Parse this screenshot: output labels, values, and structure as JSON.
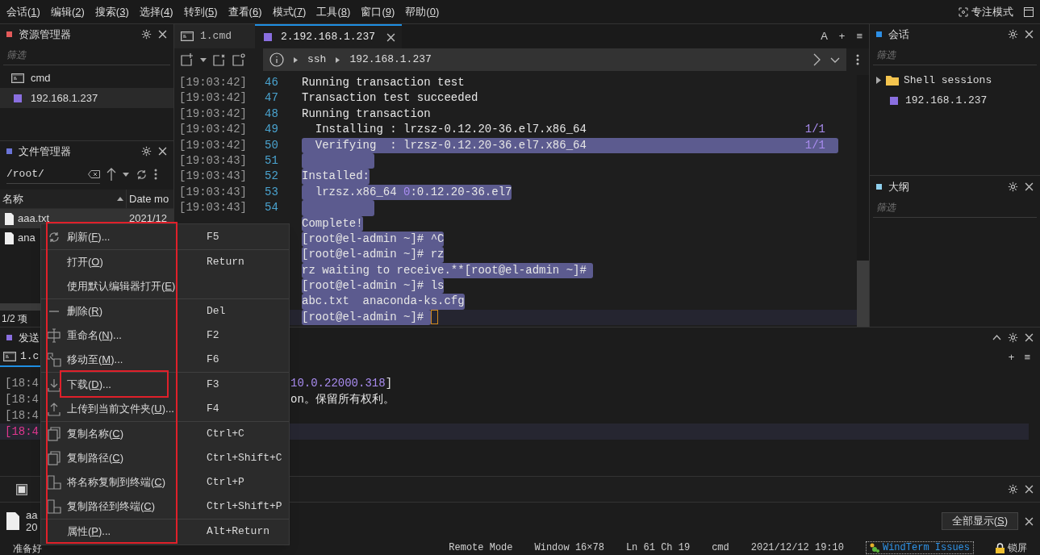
{
  "menubar": {
    "items": [
      {
        "pre": "会话(",
        "key": "1",
        "post": ")"
      },
      {
        "pre": "编辑(",
        "key": "2",
        "post": ")"
      },
      {
        "pre": "搜索(",
        "key": "3",
        "post": ")"
      },
      {
        "pre": "选择(",
        "key": "4",
        "post": ")"
      },
      {
        "pre": "转到(",
        "key": "5",
        "post": ")"
      },
      {
        "pre": "查看(",
        "key": "6",
        "post": ")"
      },
      {
        "pre": "模式(",
        "key": "7",
        "post": ")"
      },
      {
        "pre": "工具(",
        "key": "8",
        "post": ")"
      },
      {
        "pre": "窗口(",
        "key": "9",
        "post": ")"
      },
      {
        "pre": "帮助(",
        "key": "0",
        "post": ")"
      }
    ],
    "focus_mode": "专注模式"
  },
  "explorer": {
    "title": "资源管理器",
    "color": "#e35a5a",
    "filter_placeholder": "筛选",
    "items": [
      {
        "label": "cmd",
        "kind": "cmd",
        "selected": false
      },
      {
        "label": "192.168.1.237",
        "kind": "ssh",
        "selected": true
      }
    ]
  },
  "file_manager": {
    "title": "文件管理器",
    "color": "#6b74d8",
    "path": "/root/",
    "columns": [
      "名称",
      "Date mo"
    ],
    "rows": [
      {
        "name": "aaa.txt",
        "date": "2021/12",
        "selected": true
      },
      {
        "name": "ana",
        "selected": false
      }
    ],
    "status": "1/2 项"
  },
  "terminal": {
    "tabs": [
      {
        "label": "1.cmd",
        "kind": "cmd",
        "selected": false
      },
      {
        "label": "2.192.168.1.237",
        "kind": "ssh",
        "selected": true
      }
    ],
    "tab_actions": [
      "A",
      "+",
      "≡"
    ],
    "breadcrumb": [
      "ssh",
      "192.168.1.237"
    ],
    "lines": [
      {
        "stamp": "[19:03:42]",
        "num": "46",
        "selected": false,
        "segments": [
          {
            "text": "Running transaction test",
            "kind": "plain"
          }
        ]
      },
      {
        "stamp": "[19:03:42]",
        "num": "47",
        "selected": false,
        "segments": [
          {
            "text": "Transaction test succeeded",
            "kind": "plain"
          }
        ]
      },
      {
        "stamp": "[19:03:42]",
        "num": "48",
        "selected": false,
        "segments": [
          {
            "text": "Running transaction",
            "kind": "plain"
          }
        ]
      },
      {
        "stamp": "[19:03:42]",
        "num": "49",
        "selected": false,
        "segments": [
          {
            "text": "  Installing : lrzsz-0.12.20-36.el7.x86_64",
            "kind": "plain"
          }
        ],
        "tail": "1/1"
      },
      {
        "stamp": "[19:03:42]",
        "num": "50",
        "selected": true,
        "segments": [
          {
            "text": "  Verifying  : lrzsz-0.12.20-36.el7.x86_64",
            "kind": "plain"
          }
        ],
        "tail": "1/1"
      },
      {
        "stamp": "[19:03:43]",
        "num": "51",
        "selected": true
      },
      {
        "stamp": "[19:03:43]",
        "num": "52",
        "selected": true,
        "segments": [
          {
            "text": "Installed:",
            "kind": "plain"
          }
        ]
      },
      {
        "stamp": "[19:03:43]",
        "num": "53",
        "selected": true,
        "segments": [
          {
            "text": "  lrzsz.x86_64 ",
            "kind": "plain"
          },
          {
            "text": "0",
            "kind": "number"
          },
          {
            "text": ":0.12.20-36.el7",
            "kind": "plain"
          }
        ]
      },
      {
        "stamp": "[19:03:43]",
        "num": "54",
        "selected": true
      },
      {
        "selected": true,
        "segments": [
          {
            "text": "Complete!",
            "kind": "plain"
          }
        ]
      },
      {
        "selected": true,
        "segments": [
          {
            "text": "[root@el-admin ~]# ^C",
            "kind": "plain"
          }
        ]
      },
      {
        "selected": true,
        "segments": [
          {
            "text": "[root@el-admin ~]# rz",
            "kind": "plain"
          }
        ]
      },
      {
        "selected": true,
        "segments": [
          {
            "text": "rz waiting to receive.**[root@el-admin ~]# ",
            "kind": "plain"
          }
        ]
      },
      {
        "selected": true,
        "segments": [
          {
            "text": "[root@el-admin ~]# ls",
            "kind": "plain"
          }
        ]
      },
      {
        "selected": true,
        "segments": [
          {
            "text": "abc.txt  anaconda-ks.cfg",
            "kind": "plain"
          }
        ]
      },
      {
        "selected": true,
        "current": true,
        "cursor": true,
        "segments": [
          {
            "text": "[root@el-admin ~]# ",
            "kind": "plain"
          }
        ]
      }
    ]
  },
  "sessions": {
    "title": "会话",
    "color": "#2d8fe6",
    "filter_placeholder": "筛选",
    "tree": [
      {
        "label": "Shell sessions",
        "kind": "folder",
        "expanded": false
      },
      {
        "label": "192.168.1.237",
        "kind": "ssh"
      }
    ]
  },
  "outline": {
    "title": "大纲",
    "color": "#8fd0ee",
    "filter_placeholder": "筛选"
  },
  "send_panel": {
    "title": "发送",
    "color": "#8a6fe0",
    "tab": "1.c",
    "actions": [
      "+",
      "≡"
    ],
    "lines": [
      {
        "stamp": "[18:4",
        "current": false,
        "segments": [
          {
            "text": "10.0.22000.318",
            "kind": "number"
          },
          {
            "text": "]",
            "kind": "plain"
          }
        ]
      },
      {
        "stamp": "[18:4",
        "current": false,
        "segments": [
          {
            "text": "on。保留所有权利。",
            "kind": "plain"
          }
        ]
      },
      {
        "stamp": "[18:4",
        "current": false
      },
      {
        "stamp": "[18:4",
        "current": true
      }
    ]
  },
  "transfer_panel": {
    "file": "aa",
    "date": "20",
    "show_all": {
      "pre": "全部显示(",
      "key": "S",
      "post": ")"
    }
  },
  "context_menu": {
    "groups": [
      [
        {
          "pre": "刷新(",
          "key": "F",
          "post": ")...",
          "shortcut": "F5"
        }
      ],
      [
        {
          "pre": "打开(",
          "key": "O",
          "post": ")",
          "shortcut": "Return"
        },
        {
          "pre": "使用默认编辑器打开(",
          "key": "E",
          "post": ")"
        }
      ],
      [
        {
          "pre": "删除(",
          "key": "R",
          "post": ")",
          "shortcut": "Del"
        },
        {
          "pre": "重命名(",
          "key": "N",
          "post": ")...",
          "shortcut": "F2"
        },
        {
          "pre": "移动至(",
          "key": "M",
          "post": ")...",
          "shortcut": "F6"
        }
      ],
      [
        {
          "pre": "下载(",
          "key": "D",
          "post": ")...",
          "shortcut": "F3"
        },
        {
          "pre": "上传到当前文件夹(",
          "key": "U",
          "post": ")...",
          "shortcut": "F4"
        }
      ],
      [
        {
          "pre": "复制名称(",
          "key": "C",
          "post": ")",
          "shortcut": "Ctrl+C"
        },
        {
          "pre": "复制路径(",
          "key": "C",
          "post": ")",
          "shortcut": "Ctrl+Shift+C"
        },
        {
          "pre": "将名称复制到终端(",
          "key": "C",
          "post": ")",
          "shortcut": "Ctrl+P"
        },
        {
          "pre": "复制路径到终端(",
          "key": "C",
          "post": ")",
          "shortcut": "Ctrl+Shift+P"
        }
      ],
      [
        {
          "pre": "属性(",
          "key": "P",
          "post": ")...",
          "shortcut": "Alt+Return"
        }
      ]
    ]
  },
  "status_bar": {
    "left": "准备好",
    "items": [
      "Remote Mode",
      "Window 16×78",
      "Ln 61 Ch 19",
      "cmd",
      "2021/12/12 19:10"
    ],
    "link": "WindTerm Issues",
    "lock": "锁屏"
  }
}
